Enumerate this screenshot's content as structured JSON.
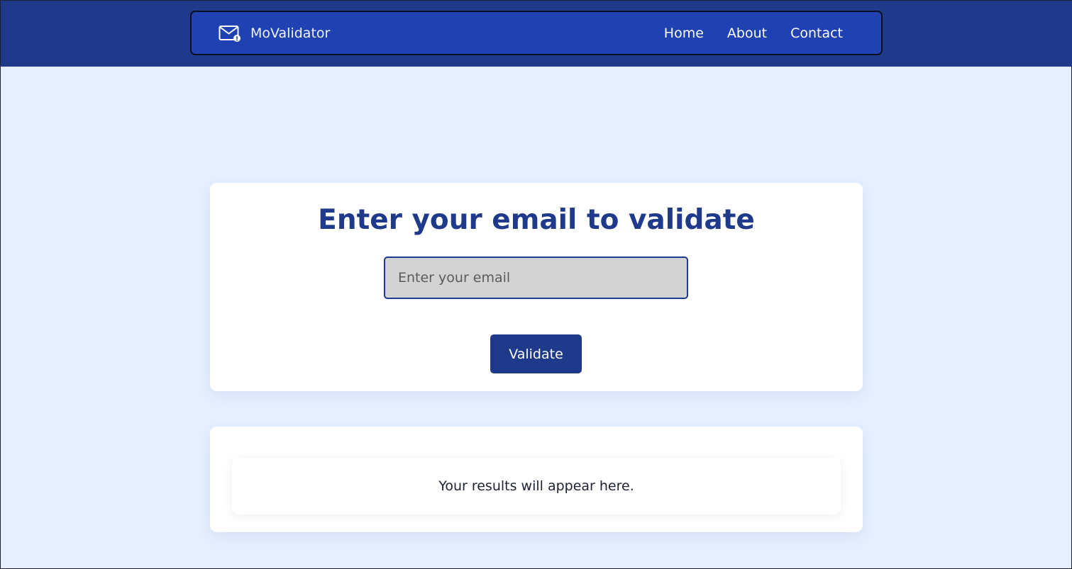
{
  "nav": {
    "brand_icon": "envelope-badge-icon",
    "brand_name": "MoValidator",
    "links": [
      {
        "label": "Home"
      },
      {
        "label": "About"
      },
      {
        "label": "Contact"
      }
    ]
  },
  "form": {
    "title": "Enter your email to validate",
    "email_placeholder": "Enter your email",
    "email_value": "",
    "validate_label": "Validate"
  },
  "results": {
    "message": "Your results will appear here."
  },
  "colors": {
    "topbar": "#1f3a8a",
    "navbar": "#1f41b2",
    "page_background": "#e5effe",
    "accent": "#1f3a8a",
    "input_background": "#d3d3d3",
    "card": "#ffffff"
  }
}
